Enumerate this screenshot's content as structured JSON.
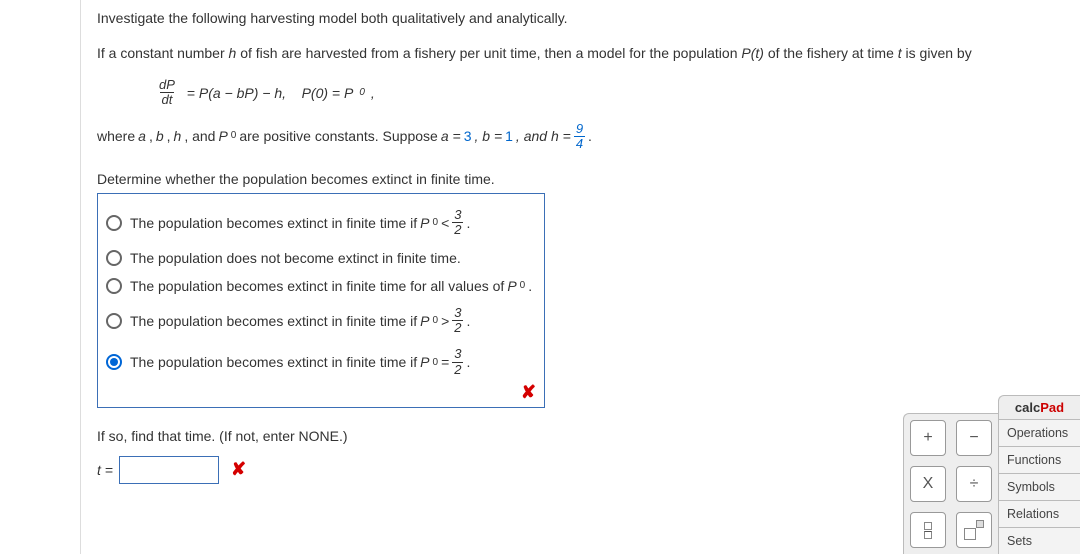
{
  "intro": "Investigate the following harvesting model both qualitatively and analytically.",
  "setup_pre": "If a constant number ",
  "setup_h": "h",
  "setup_mid1": " of fish are harvested from a fishery per unit time, then a model for the population ",
  "setup_Pt": "P(t)",
  "setup_mid2": " of the fishery at time ",
  "setup_t": "t",
  "setup_end": " is given by",
  "eq": {
    "dP": "dP",
    "dt": "dt",
    "rhs1": " = P(a − bP) − h,    P(0) = P",
    "sub0": "0",
    "comma": ","
  },
  "where": {
    "pre": "where ",
    "a": "a",
    "c1": ", ",
    "b": "b",
    "c2": ", ",
    "h": "h",
    "c3": ", and ",
    "P": "P",
    "sub0": "0",
    "mid": " are positive constants. Suppose ",
    "av": "a = ",
    "aval": "3",
    "bv": ", b = ",
    "bval": "1",
    "hv": ", and h = ",
    "fnum": "9",
    "fden": "4",
    "dot": "."
  },
  "question": "Determine whether the population becomes extinct in finite time.",
  "options": [
    {
      "pre": "The population becomes extinct in finite time if ",
      "P": "P",
      "s": "0",
      "op": " < ",
      "n": "3",
      "d": "2",
      "post": "."
    },
    {
      "pre": "The population does not become extinct in finite time."
    },
    {
      "pre": "The population becomes extinct in finite time for all values of ",
      "P": "P",
      "s": "0",
      "post": "."
    },
    {
      "pre": "The population becomes extinct in finite time if ",
      "P": "P",
      "s": "0",
      "op": " > ",
      "n": "3",
      "d": "2",
      "post": "."
    },
    {
      "pre": "The population becomes extinct in finite time if ",
      "P": "P",
      "s": "0",
      "op": " = ",
      "n": "3",
      "d": "2",
      "post": "."
    }
  ],
  "selected_index": 4,
  "wrong_mark": "✘",
  "followup": "If so, find that time. (If not, enter NONE.)",
  "answer_label": "t = ",
  "answer_value": "",
  "calcpad": {
    "title1": "calc",
    "title2": "Pad",
    "items": [
      "Operations",
      "Functions",
      "Symbols",
      "Relations",
      "Sets"
    ],
    "btn_plus": "+",
    "btn_minus": "−",
    "btn_times": "X",
    "btn_div": "÷"
  }
}
